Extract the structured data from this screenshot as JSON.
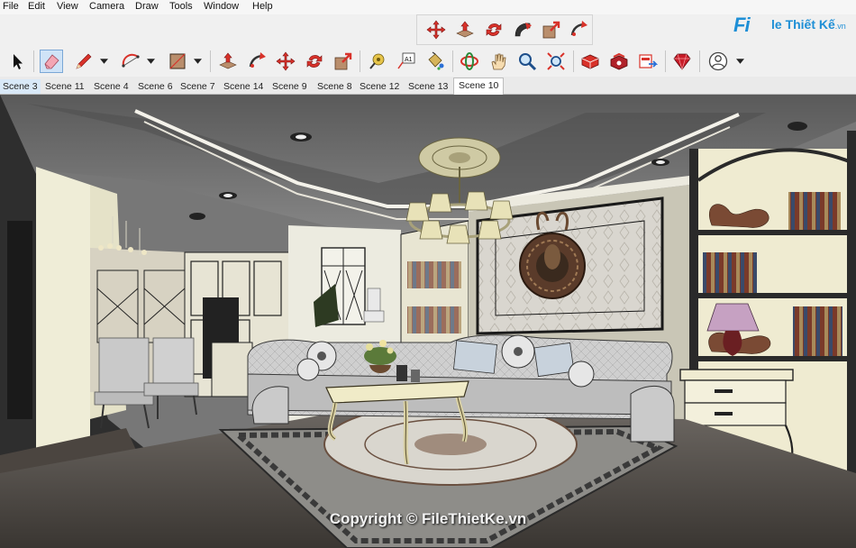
{
  "menu": [
    "File",
    "Edit",
    "View",
    "Camera",
    "Draw",
    "Tools",
    "Window",
    "Help"
  ],
  "logo": {
    "mark": "Fi",
    "name": "le Thiết Kế",
    "tld": ".vn"
  },
  "scene_tabs": [
    {
      "label": "Scene 3",
      "state": "hover"
    },
    {
      "label": "Scene 11",
      "state": "normal"
    },
    {
      "label": "Scene 4",
      "state": "normal"
    },
    {
      "label": "Scene 6",
      "state": "normal"
    },
    {
      "label": "Scene 7",
      "state": "normal"
    },
    {
      "label": "Scene 14",
      "state": "normal"
    },
    {
      "label": "Scene 9",
      "state": "normal"
    },
    {
      "label": "Scene 8",
      "state": "normal"
    },
    {
      "label": "Scene 12",
      "state": "normal"
    },
    {
      "label": "Scene 13",
      "state": "normal"
    },
    {
      "label": "Scene 10",
      "state": "active"
    }
  ],
  "watermark": "Copyright © FileThietKe.vn",
  "tools": {
    "select": "select-arrow-icon",
    "eraser": "eraser-icon",
    "line": "pencil-line-icon",
    "arc": "arc-icon",
    "rectangle": "rectangle-shape-icon",
    "push_pull": "push-pull-icon",
    "follow_me": "follow-me-icon",
    "move": "move-icon",
    "rotate": "rotate-icon",
    "scale": "scale-icon",
    "tape_measure": "tape-measure-icon",
    "text": "text-label-icon",
    "paint_bucket": "paint-bucket-icon",
    "orbit": "orbit-icon",
    "pan": "pan-hand-icon",
    "zoom": "zoom-icon",
    "zoom_extents": "zoom-extents-icon",
    "warehouse": "3d-warehouse-icon",
    "extension_warehouse": "extension-warehouse-icon",
    "send_to_layout": "send-to-layout-icon",
    "ruby": "ruby-console-icon",
    "account": "user-account-icon"
  },
  "colors": {
    "accent_red": "#d8322a",
    "selected_tool": "#cfe3f7",
    "logo_blue": "#1e8fd6"
  }
}
